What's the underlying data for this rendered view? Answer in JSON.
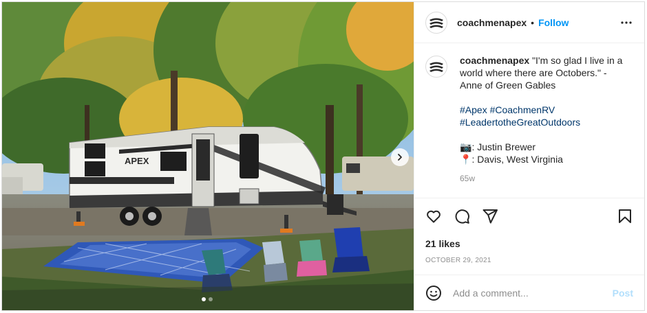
{
  "post": {
    "username": "coachmenapex",
    "separator": "•",
    "follow_label": "Follow",
    "more_icon": "more-horizontal-icon",
    "avatar_text": "APEX"
  },
  "caption": {
    "username": "coachmenapex",
    "text": "\"I'm so glad I live in a world where there are Octobers.\" - Anne of Green Gables",
    "hashtags_line1": "#Apex #CoachmenRV",
    "hashtags_line2": "#LeadertotheGreatOutdoors",
    "credit_emoji": "📷",
    "credit": ": Justin Brewer",
    "location_emoji": "📍",
    "location": ": Davis, West Virginia",
    "time_ago": "65w"
  },
  "actions": {
    "like_icon": "heart-icon",
    "comment_icon": "comment-icon",
    "share_icon": "share-icon",
    "save_icon": "bookmark-icon",
    "likes": "21 likes",
    "date": "OCTOBER 29, 2021"
  },
  "comment_box": {
    "emoji_icon": "emoji-icon",
    "placeholder": "Add a comment...",
    "post_label": "Post"
  },
  "media": {
    "next_icon": "chevron-right-icon",
    "total_slides": 2,
    "current_slide": 1,
    "trailer_brand": "APEX"
  },
  "colors": {
    "accent": "#0095f6",
    "post_disabled": "#b2dffc",
    "hashtag": "#00376b",
    "muted": "#8e8e8e"
  }
}
